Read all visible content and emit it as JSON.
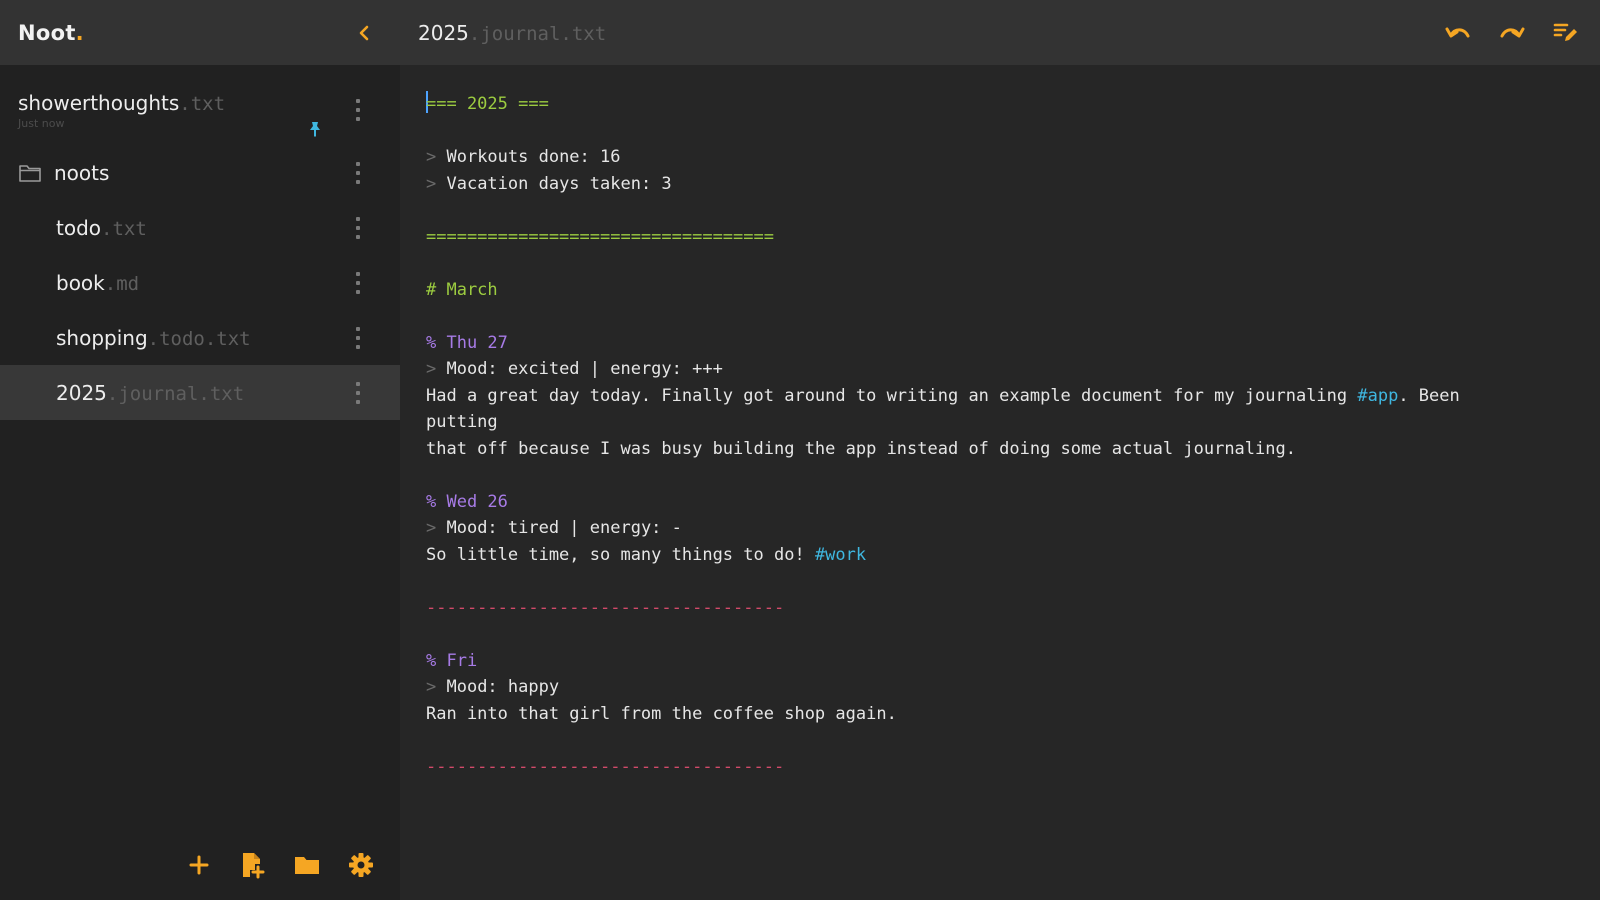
{
  "app": {
    "logo_text": "Noot",
    "logo_dot": ".",
    "colors": {
      "accent": "#f5a623",
      "pin": "#3fb7e0"
    }
  },
  "sidebar": {
    "collapse_icon": "chevron-left-icon",
    "pinned": {
      "name": "showerthoughts",
      "ext": ".txt",
      "time": "Just now"
    },
    "folder": {
      "name": "noots"
    },
    "files": [
      {
        "name": "todo",
        "ext": ".txt"
      },
      {
        "name": "book",
        "ext": ".md"
      },
      {
        "name": "shopping",
        "ext": ".todo.txt"
      },
      {
        "name": "2025",
        "ext": ".journal.txt"
      }
    ],
    "footer_icons": [
      "plus-icon",
      "new-file-icon",
      "folder-icon",
      "gear-icon"
    ]
  },
  "main": {
    "title_name": "2025",
    "title_ext": ".journal.txt",
    "header_icons": [
      "undo-icon",
      "redo-icon",
      "edit-icon"
    ],
    "editor": {
      "lines": [
        {
          "parts": [
            {
              "t": "=== 2025 ===",
              "c": "green"
            }
          ],
          "caret": true
        },
        {
          "parts": []
        },
        {
          "parts": [
            {
              "t": "> ",
              "c": "gray"
            },
            {
              "t": "Workouts done: 16"
            }
          ]
        },
        {
          "parts": [
            {
              "t": "> ",
              "c": "gray"
            },
            {
              "t": "Vacation days taken: 3"
            }
          ]
        },
        {
          "parts": []
        },
        {
          "parts": [
            {
              "t": "==================================",
              "c": "green"
            }
          ]
        },
        {
          "parts": []
        },
        {
          "parts": [
            {
              "t": "# March",
              "c": "green"
            }
          ]
        },
        {
          "parts": []
        },
        {
          "parts": [
            {
              "t": "% Thu 27",
              "c": "purple"
            }
          ]
        },
        {
          "parts": [
            {
              "t": "> ",
              "c": "gray"
            },
            {
              "t": "Mood: excited | energy: +++"
            }
          ]
        },
        {
          "parts": [
            {
              "t": "Had a great day today. Finally got around to writing an example document for my journaling "
            },
            {
              "t": "#app",
              "c": "tag"
            },
            {
              "t": ". Been"
            }
          ]
        },
        {
          "parts": [
            {
              "t": "putting"
            }
          ]
        },
        {
          "parts": [
            {
              "t": "that off because I was busy building the app instead of doing some actual journaling."
            }
          ]
        },
        {
          "parts": []
        },
        {
          "parts": [
            {
              "t": "% Wed 26",
              "c": "purple"
            }
          ]
        },
        {
          "parts": [
            {
              "t": "> ",
              "c": "gray"
            },
            {
              "t": "Mood: tired | energy: -"
            }
          ]
        },
        {
          "parts": [
            {
              "t": "So little time, so many things to do! "
            },
            {
              "t": "#work",
              "c": "tag"
            }
          ]
        },
        {
          "parts": []
        },
        {
          "parts": [
            {
              "t": "-----------------------------------",
              "c": "red"
            }
          ]
        },
        {
          "parts": []
        },
        {
          "parts": [
            {
              "t": "% Fri",
              "c": "purple"
            }
          ]
        },
        {
          "parts": [
            {
              "t": "> ",
              "c": "gray"
            },
            {
              "t": "Mood: happy"
            }
          ]
        },
        {
          "parts": [
            {
              "t": "Ran into that girl from the coffee shop again."
            }
          ]
        },
        {
          "parts": []
        },
        {
          "parts": [
            {
              "t": "-----------------------------------",
              "c": "red"
            }
          ]
        }
      ]
    }
  }
}
